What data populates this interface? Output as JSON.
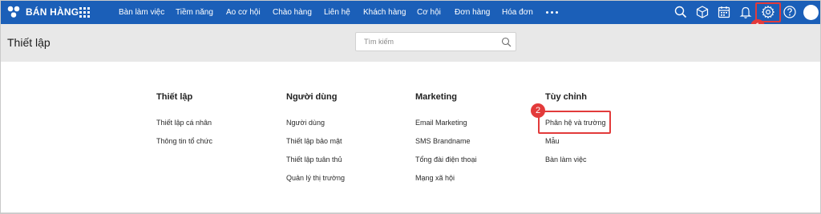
{
  "brand": {
    "name": "BÁN HÀNG"
  },
  "nav": {
    "items": [
      {
        "label": "Bàn làm việc"
      },
      {
        "label": "Tiềm năng"
      },
      {
        "label": "Ao cơ hội"
      },
      {
        "label": "Chào hàng"
      },
      {
        "label": "Liên hệ"
      },
      {
        "label": "Khách hàng"
      },
      {
        "label": "Cơ hội"
      },
      {
        "label": "Đơn hàng"
      },
      {
        "label": "Hóa đơn"
      }
    ],
    "icons": [
      "search-icon",
      "box-icon",
      "calendar-icon",
      "bell-icon",
      "gear-icon",
      "help-icon"
    ]
  },
  "header": {
    "title": "Thiết lập",
    "search_placeholder": "Tìm kiếm"
  },
  "columns": [
    {
      "title": "Thiết lập",
      "links": [
        "Thiết lập cá nhân",
        "Thông tin tổ chức"
      ]
    },
    {
      "title": "Người dùng",
      "links": [
        "Người dùng",
        "Thiết lập bảo mật",
        "Thiết lập tuân thủ",
        "Quản lý thị trường"
      ]
    },
    {
      "title": "Marketing",
      "links": [
        "Email Marketing",
        "SMS Brandname",
        "Tổng đài điện thoại",
        "Mạng xã hội"
      ]
    },
    {
      "title": "Tùy chỉnh",
      "links": [
        "Phân hệ và trường",
        "Mẫu",
        "Bàn làm việc"
      ]
    }
  ],
  "annotations": {
    "step1": "1",
    "step2": "2"
  },
  "colors": {
    "topbar": "#1b5fb8",
    "subbar": "#e8e8e8",
    "highlight": "#e23b3b"
  }
}
